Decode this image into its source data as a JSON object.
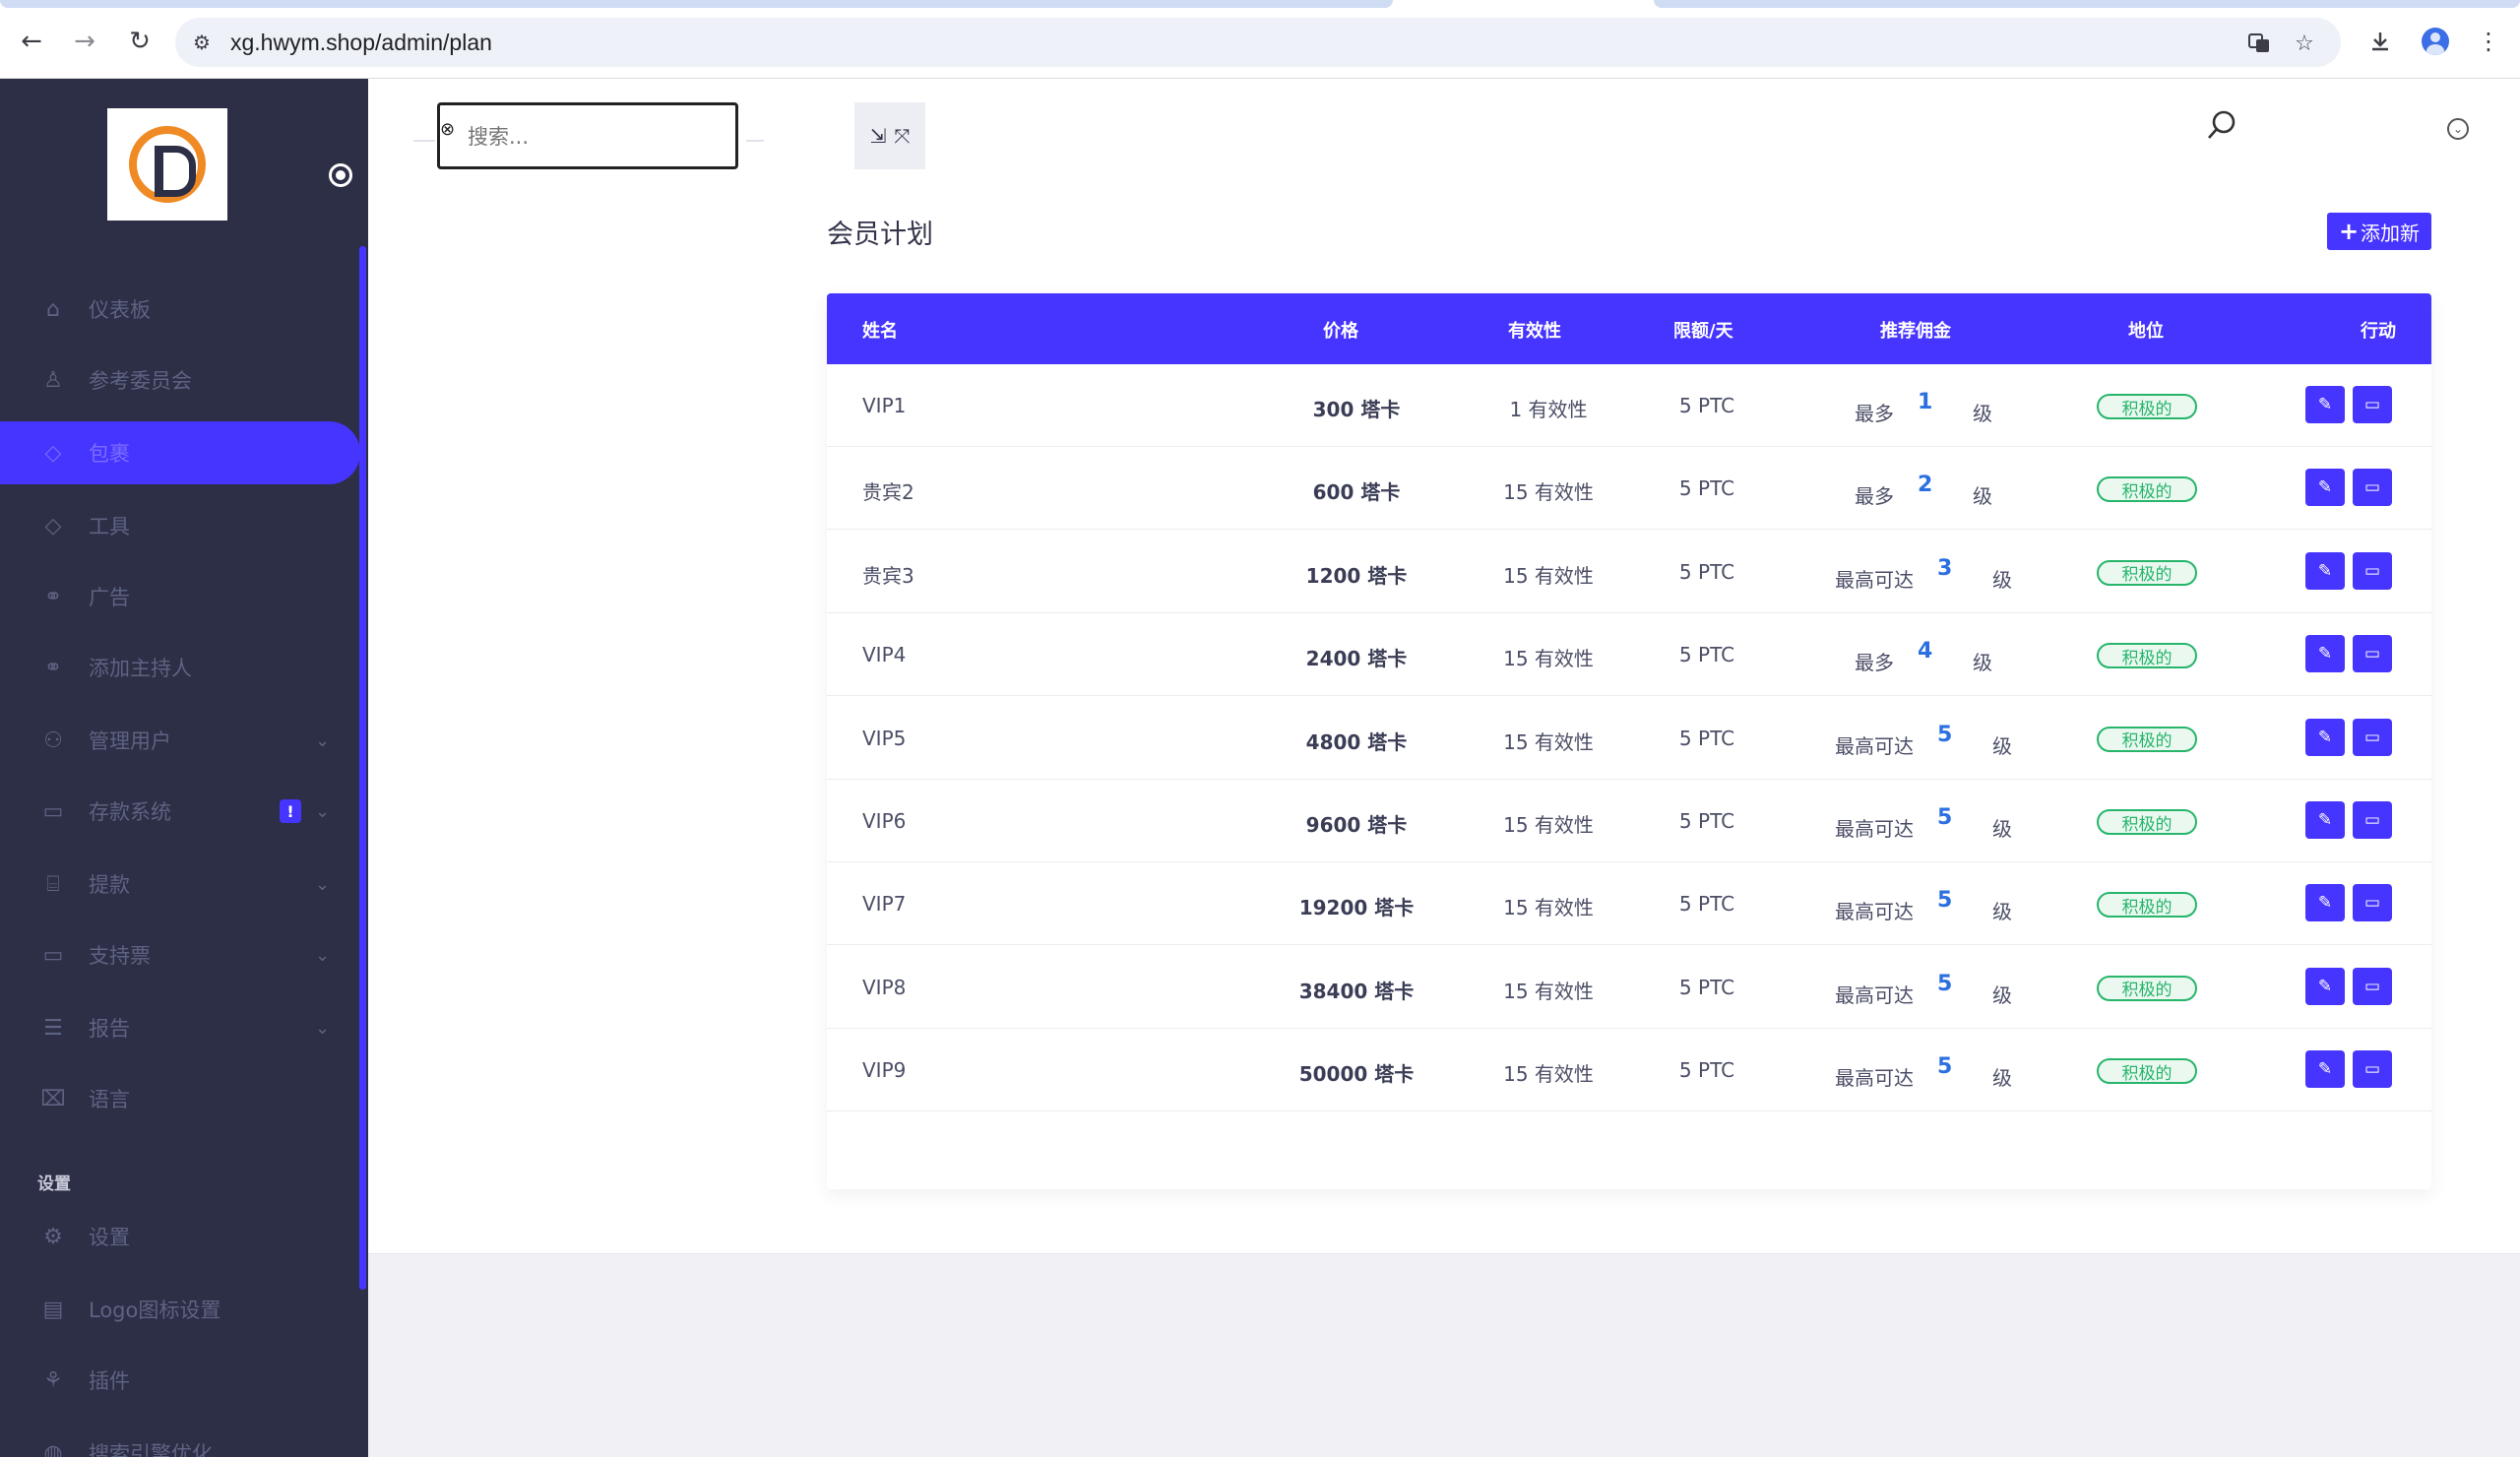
{
  "browser": {
    "url": "xg.hwym.shop/admin/plan",
    "icons": [
      "back-icon",
      "forward-icon",
      "reload-icon",
      "site-info-icon",
      "translate-icon",
      "bookmark-star-icon",
      "download-icon",
      "profile-icon",
      "more-vert-icon"
    ]
  },
  "sidebar": {
    "items": [
      {
        "label": "仪表板",
        "icon": "home-icon"
      },
      {
        "label": "参考委员会",
        "icon": "bell-icon"
      },
      {
        "label": "包裹",
        "icon": "tag-icon",
        "active": true
      },
      {
        "label": "工具",
        "icon": "tag-icon"
      },
      {
        "label": "广告",
        "icon": "link-icon"
      },
      {
        "label": "添加主持人",
        "icon": "link-icon"
      },
      {
        "label": "管理用户",
        "icon": "users-icon",
        "caret": true
      },
      {
        "label": "存款系统",
        "icon": "card-icon",
        "caret": true,
        "badge": "!"
      },
      {
        "label": "提款",
        "icon": "bank-icon",
        "caret": true
      },
      {
        "label": "支持票",
        "icon": "ticket-icon",
        "caret": true
      },
      {
        "label": "报告",
        "icon": "list-icon",
        "caret": true
      },
      {
        "label": "语言",
        "icon": "language-icon"
      }
    ],
    "section_label": "设置",
    "settings_items": [
      {
        "label": "设置",
        "icon": "gear-icon"
      },
      {
        "label": "Logo图标设置",
        "icon": "image-icon"
      },
      {
        "label": "插件",
        "icon": "plugin-icon"
      },
      {
        "label": "搜索引擎优化",
        "icon": "globe-icon"
      }
    ]
  },
  "topbar": {
    "search_placeholder": "搜索...",
    "fullscreen_icon": "⤡ ⤢"
  },
  "page": {
    "title": "会员计划",
    "add_button_plus": "+",
    "add_button_label": "添加新"
  },
  "table": {
    "headers": {
      "name": "姓名",
      "price": "价格",
      "validity": "有效性",
      "limit": "限额/天",
      "referral": "推荐佣金",
      "status": "地位",
      "action": "行动"
    },
    "rows": [
      {
        "name": "VIP1",
        "price": "300 塔卡",
        "validity": "1 有效性",
        "limit": "5 PTC",
        "ref_prefix": "最多",
        "ref_level": "1",
        "ref_suffix": "级",
        "status": "积极的"
      },
      {
        "name": "贵宾2",
        "price": "600 塔卡",
        "validity": "15 有效性",
        "limit": "5 PTC",
        "ref_prefix": "最多",
        "ref_level": "2",
        "ref_suffix": "级",
        "status": "积极的"
      },
      {
        "name": "贵宾3",
        "price": "1200 塔卡",
        "validity": "15 有效性",
        "limit": "5 PTC",
        "ref_prefix": "最高可达",
        "ref_level": "3",
        "ref_suffix": "级",
        "status": "积极的"
      },
      {
        "name": "VIP4",
        "price": "2400 塔卡",
        "validity": "15 有效性",
        "limit": "5 PTC",
        "ref_prefix": "最多",
        "ref_level": "4",
        "ref_suffix": "级",
        "status": "积极的"
      },
      {
        "name": "VIP5",
        "price": "4800 塔卡",
        "validity": "15 有效性",
        "limit": "5 PTC",
        "ref_prefix": "最高可达",
        "ref_level": "5",
        "ref_suffix": "级",
        "status": "积极的"
      },
      {
        "name": "VIP6",
        "price": "9600 塔卡",
        "validity": "15 有效性",
        "limit": "5 PTC",
        "ref_prefix": "最高可达",
        "ref_level": "5",
        "ref_suffix": "级",
        "status": "积极的"
      },
      {
        "name": "VIP7",
        "price": "19200 塔卡",
        "validity": "15 有效性",
        "limit": "5 PTC",
        "ref_prefix": "最高可达",
        "ref_level": "5",
        "ref_suffix": "级",
        "status": "积极的"
      },
      {
        "name": "VIP8",
        "price": "38400 塔卡",
        "validity": "15 有效性",
        "limit": "5 PTC",
        "ref_prefix": "最高可达",
        "ref_level": "5",
        "ref_suffix": "级",
        "status": "积极的"
      },
      {
        "name": "VIP9",
        "price": "50000 塔卡",
        "validity": "15 有效性",
        "limit": "5 PTC",
        "ref_prefix": "最高可达",
        "ref_level": "5",
        "ref_suffix": "级",
        "status": "积极的"
      }
    ]
  },
  "colors": {
    "accent": "#4634ff",
    "sidebar_bg": "#2c2f45",
    "status_green": "#26b56b",
    "level_blue": "#2b6fe0"
  }
}
